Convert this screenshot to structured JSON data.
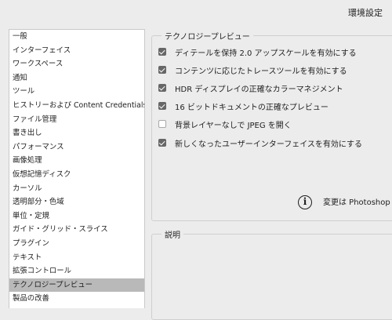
{
  "window": {
    "title": "環境設定"
  },
  "sidebar": {
    "items": [
      {
        "label": "一般"
      },
      {
        "label": "インターフェイス"
      },
      {
        "label": "ワークスペース"
      },
      {
        "label": "通知"
      },
      {
        "label": "ツール"
      },
      {
        "label": "ヒストリーおよび Content Credentials"
      },
      {
        "label": "ファイル管理"
      },
      {
        "label": "書き出し"
      },
      {
        "label": "パフォーマンス"
      },
      {
        "label": "画像処理"
      },
      {
        "label": "仮想記憶ディスク"
      },
      {
        "label": "カーソル"
      },
      {
        "label": "透明部分・色域"
      },
      {
        "label": "単位・定規"
      },
      {
        "label": "ガイド・グリッド・スライス"
      },
      {
        "label": "プラグイン"
      },
      {
        "label": "テキスト"
      },
      {
        "label": "拡張コントロール"
      },
      {
        "label": "テクノロジープレビュー",
        "selected": true
      },
      {
        "label": "製品の改善"
      }
    ]
  },
  "preview": {
    "title": "テクノロジープレビュー",
    "options": [
      {
        "label": "ディテールを保持 2.0 アップスケールを有効にする",
        "checked": true
      },
      {
        "label": "コンテンツに応じたトレースツールを有効にする",
        "checked": true
      },
      {
        "label": "HDR ディスプレイの正確なカラーマネジメント",
        "checked": true
      },
      {
        "label": "16 ビットドキュメントの正確なプレビュー",
        "checked": true
      },
      {
        "label": "背景レイヤーなしで JPEG を開く",
        "checked": false
      },
      {
        "label": "新しくなったユーザーインターフェイスを有効にする",
        "checked": true
      }
    ],
    "info_text": "変更は Photoshop",
    "info_icon": "info-icon"
  },
  "description": {
    "title": "説明"
  },
  "colors": {
    "selection": "#b9b9b9",
    "checkbox_on": "#676767",
    "background": "#ececec"
  }
}
